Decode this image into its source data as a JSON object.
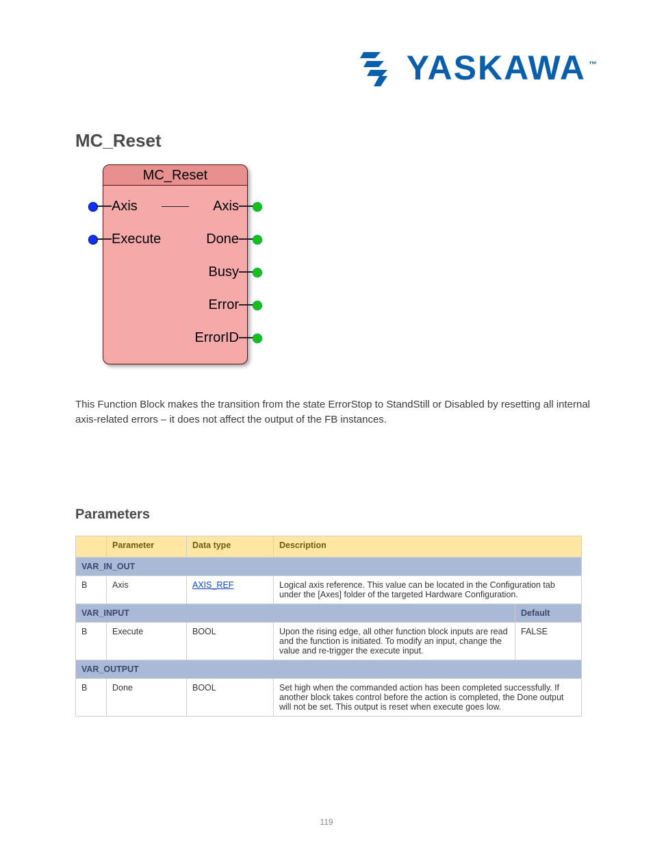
{
  "brand": {
    "name": "YASKAWA",
    "tm": "™"
  },
  "heading": "MC_Reset",
  "fb": {
    "title": "MC_Reset",
    "inputs": [
      "Axis",
      "Execute"
    ],
    "outputs": [
      "Axis",
      "Done",
      "Busy",
      "Error",
      "ErrorID"
    ]
  },
  "description": "This Function Block makes the transition from the state ErrorStop to StandStill or Disabled by resetting all internal axis-related errors – it does not affect the output of the FB instances.",
  "params_heading": "Parameters",
  "table": {
    "headers": [
      "",
      "Parameter",
      "Data type",
      "Description"
    ],
    "sections": [
      {
        "title": "VAR_IN_OUT",
        "rows": [
          {
            "idx": "B",
            "name": "Axis",
            "type": "AXIS_REF",
            "type_is_link": true,
            "desc": "Logical axis reference. This value can be located in the Configuration tab under the [Axes] folder of the targeted Hardware Configuration."
          }
        ]
      },
      {
        "title": "VAR_INPUT",
        "default_header": "Default",
        "rows": [
          {
            "idx": "B",
            "name": "Execute",
            "type": "BOOL",
            "desc": "Upon the rising edge, all other function block inputs are read and the function is initiated. To modify an input, change the value and re-trigger the execute input.",
            "default": "FALSE"
          }
        ]
      },
      {
        "title": "VAR_OUTPUT",
        "rows": [
          {
            "idx": "B",
            "name": "Done",
            "type": "BOOL",
            "desc": "Set high when the commanded action has been completed successfully. If another block takes control before the action is completed, the Done output will not be set. This output is reset when execute goes low."
          }
        ]
      }
    ]
  },
  "page_number": "119"
}
